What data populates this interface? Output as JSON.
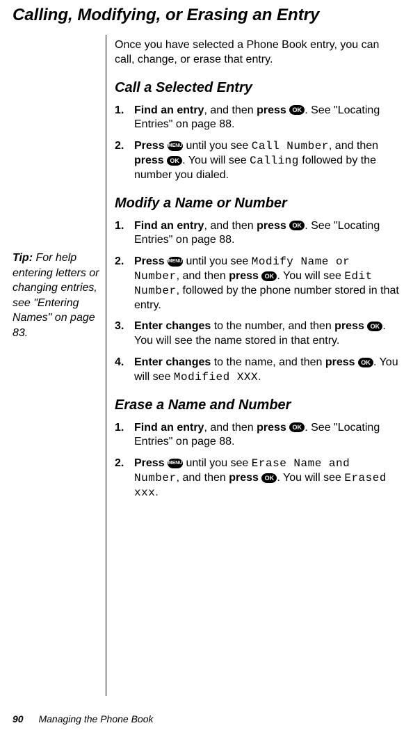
{
  "title": "Calling, Modifying, or Erasing an Entry",
  "intro": "Once you have selected a Phone Book entry, you can call, change, or erase that entry.",
  "sidebar": {
    "tiplabel": "Tip:",
    "tiptext": " For help entering letters or changing entries, see \"Entering Names\" on page 83."
  },
  "buttons": {
    "ok": "OK",
    "menu": "MENU"
  },
  "sections": [
    {
      "heading": "Call a Selected Entry",
      "steps": [
        {
          "segments": [
            {
              "t": "Find an entry",
              "cls": "bold"
            },
            {
              "t": ", and then "
            },
            {
              "t": "press",
              "cls": "bold"
            },
            {
              "t": " "
            },
            {
              "btn": "ok"
            },
            {
              "t": ". See \"Locating Entries\" on page 88."
            }
          ]
        },
        {
          "segments": [
            {
              "t": "Press",
              "cls": "bold"
            },
            {
              "t": " "
            },
            {
              "btn": "menu"
            },
            {
              "t": " until you see "
            },
            {
              "t": "Call Number",
              "cls": "lcd"
            },
            {
              "t": ", and then "
            },
            {
              "t": "press",
              "cls": "bold"
            },
            {
              "t": " "
            },
            {
              "btn": "ok"
            },
            {
              "t": ". You will see "
            },
            {
              "t": "Calling",
              "cls": "lcd"
            },
            {
              "t": " followed by the number you dialed."
            }
          ]
        }
      ]
    },
    {
      "heading": "Modify a Name or Number",
      "steps": [
        {
          "segments": [
            {
              "t": "Find an entry",
              "cls": "bold"
            },
            {
              "t": ", and then "
            },
            {
              "t": "press",
              "cls": "bold"
            },
            {
              "t": " "
            },
            {
              "btn": "ok"
            },
            {
              "t": ". See \"Locating Entries\" on page 88."
            }
          ]
        },
        {
          "segments": [
            {
              "t": "Press",
              "cls": "bold"
            },
            {
              "t": " "
            },
            {
              "btn": "menu"
            },
            {
              "t": " until you see "
            },
            {
              "t": "Modify Name or Number",
              "cls": "lcd"
            },
            {
              "t": ", and then "
            },
            {
              "t": "press",
              "cls": "bold"
            },
            {
              "t": " "
            },
            {
              "btn": "ok"
            },
            {
              "t": ". You will see "
            },
            {
              "t": "Edit Number",
              "cls": "lcd"
            },
            {
              "t": ", followed by the phone number stored in that entry."
            }
          ]
        },
        {
          "segments": [
            {
              "t": "Enter changes",
              "cls": "bold"
            },
            {
              "t": " to the number, and then "
            },
            {
              "t": "press",
              "cls": "bold"
            },
            {
              "t": " "
            },
            {
              "btn": "ok"
            },
            {
              "t": ". You will see the name stored in that entry."
            }
          ]
        },
        {
          "segments": [
            {
              "t": "Enter changes",
              "cls": "bold"
            },
            {
              "t": " to the name, and then "
            },
            {
              "t": "press",
              "cls": "bold"
            },
            {
              "t": " "
            },
            {
              "btn": "ok"
            },
            {
              "t": ". You will see "
            },
            {
              "t": "Modified XXX",
              "cls": "lcd"
            },
            {
              "t": "."
            }
          ]
        }
      ]
    },
    {
      "heading": "Erase a Name and Number",
      "steps": [
        {
          "segments": [
            {
              "t": "Find an entry",
              "cls": "bold"
            },
            {
              "t": ", and then "
            },
            {
              "t": "press",
              "cls": "bold"
            },
            {
              "t": " "
            },
            {
              "btn": "ok"
            },
            {
              "t": ". See \"Locating Entries\" on page 88."
            }
          ]
        },
        {
          "segments": [
            {
              "t": "Press",
              "cls": "bold"
            },
            {
              "t": " "
            },
            {
              "btn": "menu"
            },
            {
              "t": " until you see "
            },
            {
              "t": "Erase Name and Number",
              "cls": "lcd"
            },
            {
              "t": ", and then "
            },
            {
              "t": "press",
              "cls": "bold"
            },
            {
              "t": " "
            },
            {
              "btn": "ok"
            },
            {
              "t": ". You will see "
            },
            {
              "t": "Erased xxx",
              "cls": "lcd"
            },
            {
              "t": "."
            }
          ]
        }
      ]
    }
  ],
  "footer": {
    "page": "90",
    "chapter": "Managing the Phone Book"
  }
}
